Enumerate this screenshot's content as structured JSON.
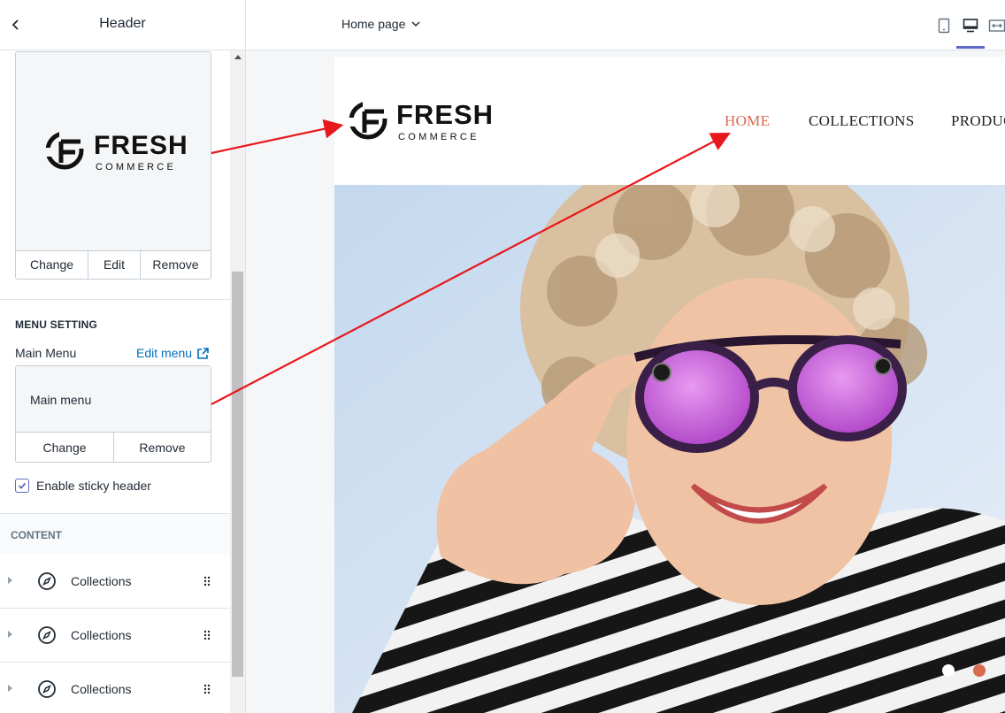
{
  "sidebar": {
    "title": "Header",
    "logo_buttons": {
      "change": "Change",
      "edit": "Edit",
      "remove": "Remove"
    },
    "menu_setting": {
      "heading": "MENU SETTING",
      "label": "Main Menu",
      "edit_link": "Edit menu",
      "value": "Main menu",
      "change": "Change",
      "remove": "Remove"
    },
    "sticky": {
      "label": "Enable sticky header",
      "checked": true
    },
    "content": {
      "heading": "CONTENT",
      "blocks": [
        {
          "label": "Collections",
          "icon": "compass-icon"
        },
        {
          "label": "Collections",
          "icon": "compass-icon"
        },
        {
          "label": "Collections",
          "icon": "compass-icon"
        }
      ]
    }
  },
  "topbar": {
    "page_select": "Home page",
    "devices": [
      "mobile-icon",
      "desktop-icon",
      "fullscreen-icon"
    ],
    "active_device": "desktop"
  },
  "brand": {
    "name": "FRESH",
    "tagline": "COMMERCE"
  },
  "preview": {
    "nav": [
      {
        "label": "HOME",
        "active": true
      },
      {
        "label": "COLLECTIONS",
        "active": false
      },
      {
        "label": "PRODUC",
        "active": false
      }
    ],
    "slides": 2,
    "active_slide": 1
  },
  "colors": {
    "accent": "#5c6ac4",
    "link": "#006fbb",
    "nav_active": "#d9694f",
    "annotation_arrow": "#e8171c"
  }
}
